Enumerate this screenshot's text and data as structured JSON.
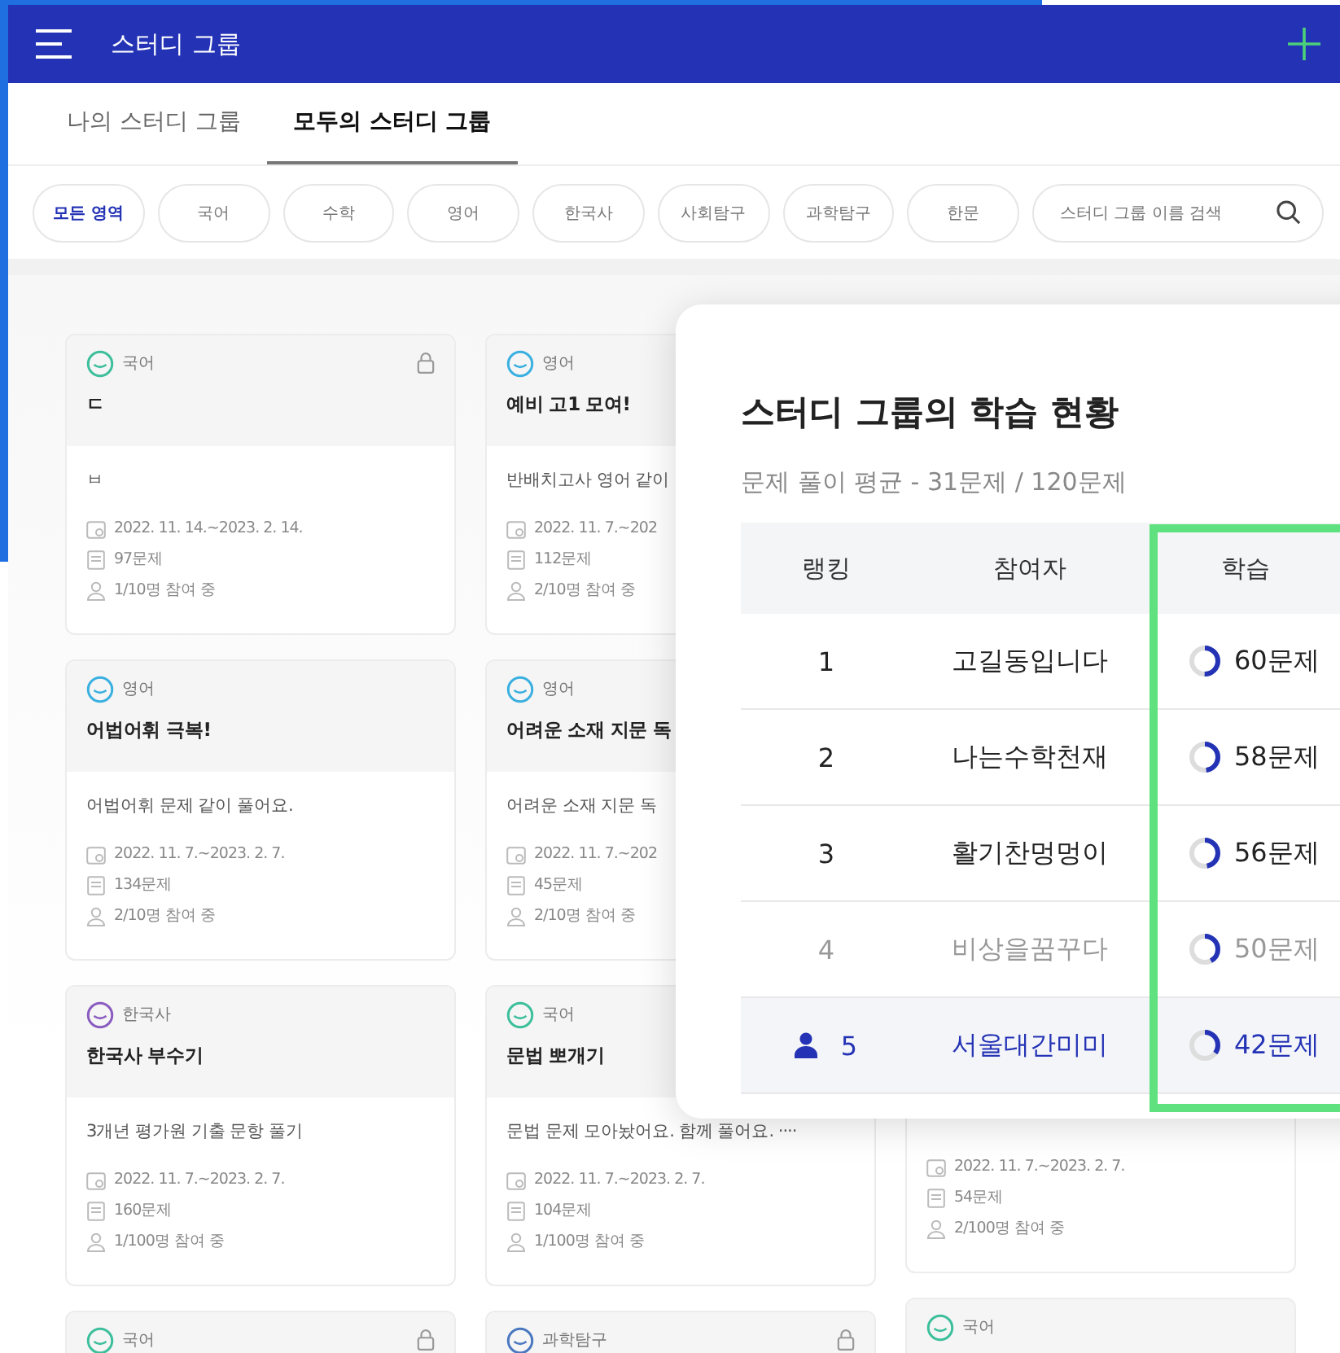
{
  "app_bar": {
    "title": "스터디 그룹"
  },
  "tabs": [
    {
      "label": "나의 스터디 그룹",
      "selected": false
    },
    {
      "label": "모두의 스터디 그룹",
      "selected": true
    }
  ],
  "filters": [
    {
      "label": "모든 영역",
      "selected": true
    },
    {
      "label": "국어",
      "selected": false
    },
    {
      "label": "수학",
      "selected": false
    },
    {
      "label": "영어",
      "selected": false
    },
    {
      "label": "한국사",
      "selected": false
    },
    {
      "label": "사회탐구",
      "selected": false
    },
    {
      "label": "과학탐구",
      "selected": false
    },
    {
      "label": "한문",
      "selected": false
    }
  ],
  "search": {
    "placeholder": "스터디 그룹 이름 검색"
  },
  "card_columns": [
    {
      "cards": [
        {
          "subject": "국어",
          "color": "#3dbf9c",
          "locked": true,
          "title": "ㄷ",
          "description": "ㅂ",
          "period": "2022. 11. 14.~2023. 2. 14.",
          "problems": "97문제",
          "members": "1/10명 참여 중"
        },
        {
          "subject": "영어",
          "color": "#3ab0e0",
          "locked": false,
          "title": "어법어휘 극복!",
          "description": "어법어휘 문제 같이 풀어요.",
          "period": "2022. 11. 7.~2023. 2. 7.",
          "problems": "134문제",
          "members": "2/10명 참여 중"
        },
        {
          "subject": "한국사",
          "color": "#8a5cc0",
          "locked": false,
          "title": "한국사 부수기",
          "description": "3개년 평가원 기출 문항 풀기",
          "period": "2022. 11. 7.~2023. 2. 7.",
          "problems": "160문제",
          "members": "1/100명 참여 중"
        },
        {
          "subject": "국어",
          "color": "#3dbf9c",
          "locked": true
        }
      ]
    },
    {
      "cards": [
        {
          "subject": "영어",
          "color": "#3ab0e0",
          "title": "예비 고1 모여!",
          "description": "반배치고사 영어 같이",
          "period": "2022. 11. 7.~202",
          "problems": "112문제",
          "members": "2/10명 참여 중"
        },
        {
          "subject": "영어",
          "color": "#3ab0e0",
          "title": "어려운 소재 지문 독",
          "description": "어려운 소재 지문 독",
          "period": "2022. 11. 7.~202",
          "problems": "45문제",
          "members": "2/10명 참여 중"
        },
        {
          "subject": "국어",
          "color": "#3dbf9c",
          "title": "문법 뽀개기",
          "description": "문법 문제 모아놨어요. 함께 풀어요. ····",
          "period": "2022. 11. 7.~2023. 2. 7.",
          "problems": "104문제",
          "members": "1/100명 참여 중"
        },
        {
          "subject": "과학탐구",
          "color": "#4a78c0",
          "locked": true
        }
      ]
    },
    {
      "cards": [
        {
          "period": "2022. 11. 7.~2023. 2. 7.",
          "problems": "54문제",
          "members": "2/100명 참여 중"
        },
        {
          "subject": "국어",
          "color": "#3dbf9c",
          "locked": false
        }
      ]
    }
  ],
  "ranking": {
    "title": "스터디 그룹의 학습 현황",
    "subtitle": "문제 풀이 평균 - 31문제 / 120문제",
    "columns": [
      "랭킹",
      "참여자",
      "학습"
    ],
    "rows": [
      {
        "kind": "normal",
        "rank": "1",
        "name": "고길동입니다",
        "solved": "60문제",
        "level": 0.5
      },
      {
        "kind": "normal",
        "rank": "2",
        "name": "나는수학천재",
        "solved": "58문제",
        "level": 0.48
      },
      {
        "kind": "normal",
        "rank": "3",
        "name": "활기찬멍멍이",
        "solved": "56문제",
        "level": 0.47
      },
      {
        "kind": "dimmed",
        "rank": "4",
        "name": "비상을꿈꾸다",
        "solved": "50문제",
        "level": 0.42
      },
      {
        "kind": "self",
        "rank": "5",
        "name": "서울대간미미",
        "solved": "42문제",
        "level": 0.35
      }
    ]
  }
}
